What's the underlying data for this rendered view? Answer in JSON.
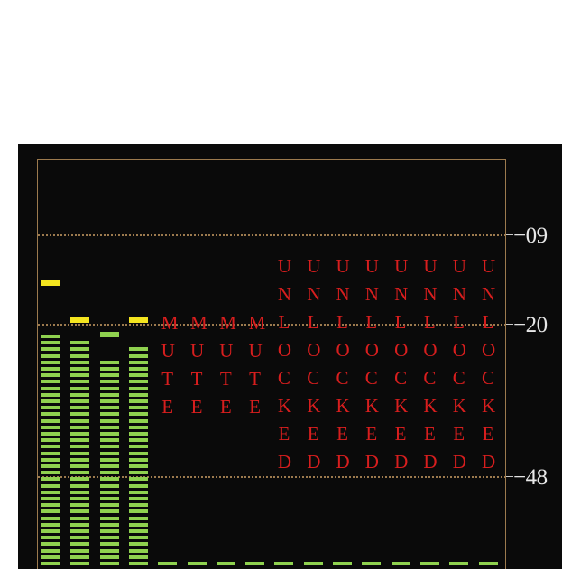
{
  "scale": {
    "labels": [
      {
        "text": "−09",
        "db": -9
      },
      {
        "text": "−20",
        "db": -20
      },
      {
        "text": "−48",
        "db": -48
      }
    ]
  },
  "colors": {
    "panel": "#0a0a0a",
    "frame": "#9c7a4e",
    "meter_segment": "#8fd14f",
    "peak_yellow": "#f4e51f",
    "peak_green": "#8fd14f",
    "status_label": "#d81e1e",
    "scale_text": "#e8e8e8"
  },
  "channels": [
    {
      "name": "ch1",
      "level_db": -21,
      "peak_db": -15,
      "peak_color": "yellow",
      "status": ""
    },
    {
      "name": "ch2",
      "level_db": -22.5,
      "peak_db": -19.5,
      "peak_color": "yellow",
      "status": ""
    },
    {
      "name": "ch3",
      "level_db": -26.5,
      "peak_db": -22,
      "peak_color": "green",
      "status": ""
    },
    {
      "name": "ch4",
      "level_db": -24,
      "peak_db": -19.5,
      "peak_color": "yellow",
      "status": ""
    },
    {
      "name": "ch5",
      "level_db": -60,
      "status": "MUTE"
    },
    {
      "name": "ch6",
      "level_db": -60,
      "status": "MUTE"
    },
    {
      "name": "ch7",
      "level_db": -60,
      "status": "MUTE"
    },
    {
      "name": "ch8",
      "level_db": -60,
      "status": "MUTE"
    },
    {
      "name": "ch9",
      "level_db": -60,
      "status": "UNLOCKED"
    },
    {
      "name": "ch10",
      "level_db": -60,
      "status": "UNLOCKED"
    },
    {
      "name": "ch11",
      "level_db": -60,
      "status": "UNLOCKED"
    },
    {
      "name": "ch12",
      "level_db": -60,
      "status": "UNLOCKED"
    },
    {
      "name": "ch13",
      "level_db": -60,
      "status": "UNLOCKED"
    },
    {
      "name": "ch14",
      "level_db": -60,
      "status": "UNLOCKED"
    },
    {
      "name": "ch15",
      "level_db": -60,
      "status": "UNLOCKED"
    },
    {
      "name": "ch16",
      "level_db": -60,
      "status": "UNLOCKED"
    }
  ]
}
